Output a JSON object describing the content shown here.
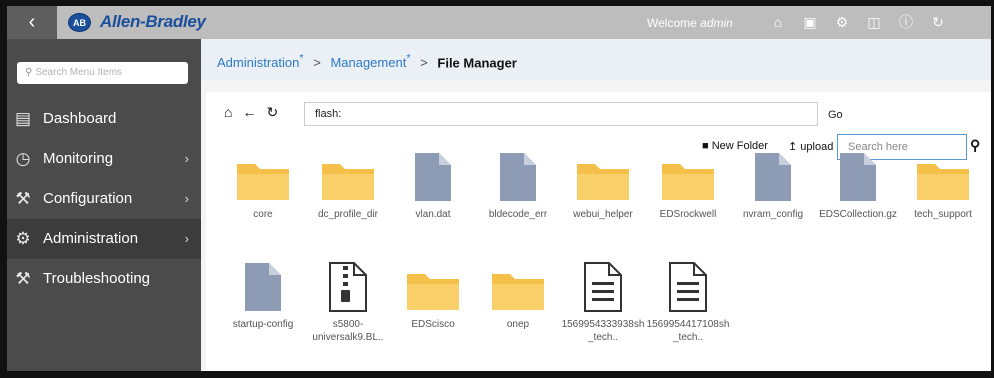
{
  "header": {
    "back_icon": "chevron-left-icon",
    "logo_badge": "AB",
    "brand": "Allen-Bradley",
    "welcome_prefix": "Welcome",
    "welcome_user": "admin",
    "icons": [
      "home-icon",
      "save-icon",
      "gear-icon",
      "network-icon",
      "help-icon",
      "refresh-icon"
    ]
  },
  "sidebar": {
    "search_placeholder": "Search Menu Items",
    "items": [
      {
        "label": "Dashboard",
        "icon": "dashboard-icon",
        "has_chevron": false
      },
      {
        "label": "Monitoring",
        "icon": "monitoring-icon",
        "has_chevron": true
      },
      {
        "label": "Configuration",
        "icon": "wrench-icon",
        "has_chevron": true
      },
      {
        "label": "Administration",
        "icon": "gear-icon",
        "has_chevron": true
      },
      {
        "label": "Troubleshooting",
        "icon": "tools-icon",
        "has_chevron": false
      }
    ]
  },
  "breadcrumb": {
    "items": [
      "Administration",
      "Management",
      "File Manager"
    ],
    "marker": "*",
    "separator": ">"
  },
  "toolbar": {
    "path": "flash:",
    "go_label": "Go",
    "new_folder_label": "New Folder",
    "upload_label": "upload",
    "search_placeholder": "Search here"
  },
  "files": [
    {
      "name": "core",
      "type": "folder"
    },
    {
      "name": "dc_profile_dir",
      "type": "folder"
    },
    {
      "name": "vlan.dat",
      "type": "file"
    },
    {
      "name": "bldecode_err",
      "type": "file"
    },
    {
      "name": "webui_helper",
      "type": "folder"
    },
    {
      "name": "EDSrockwell",
      "type": "folder"
    },
    {
      "name": "nvram_config",
      "type": "file"
    },
    {
      "name": "EDSCollection.gz",
      "type": "file"
    },
    {
      "name": "tech_support",
      "type": "folder"
    },
    {
      "name": "startup-config",
      "type": "file"
    },
    {
      "name": "s5800-universalk9.BL..",
      "type": "zip"
    },
    {
      "name": "EDScisco",
      "type": "folder"
    },
    {
      "name": "onep",
      "type": "folder"
    },
    {
      "name": "1569954333938sh_tech..",
      "type": "text"
    },
    {
      "name": "1569954417108sh_tech..",
      "type": "text"
    }
  ],
  "colors": {
    "folder": "#f5c04a",
    "file": "#8d9bb5",
    "header_bg": "#bdbdbd",
    "sidebar_bg": "#4b4b4b",
    "link": "#2f79c4"
  }
}
